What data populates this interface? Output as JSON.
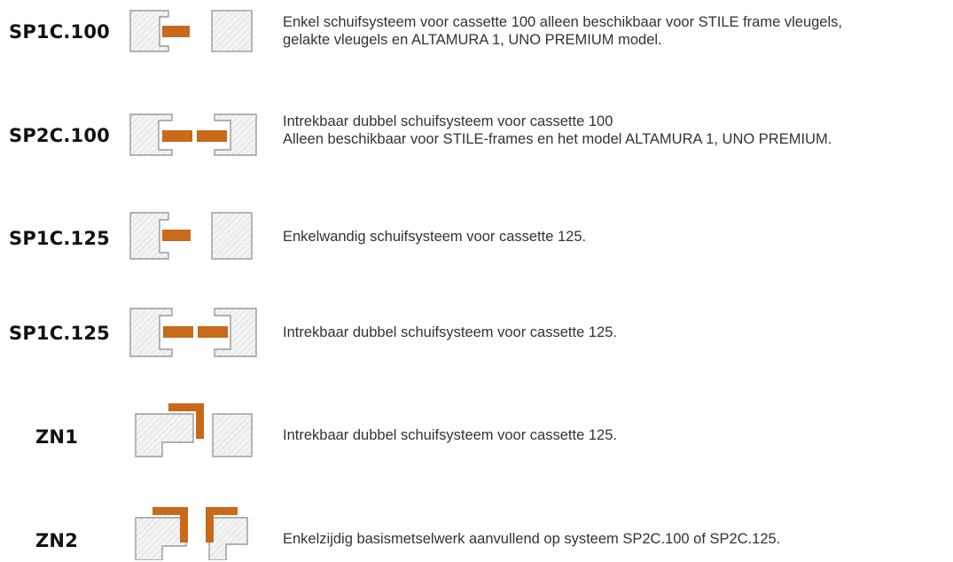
{
  "colors": {
    "accent": "#c9691a",
    "outline": "#9a9a9a",
    "hatch": "#d9d9d9"
  },
  "rows": [
    {
      "code": "SP1C.100",
      "diagram": "single-slider-cassette-icon",
      "lines": [
        "Enkel schuifsysteem voor cassette 100 alleen beschikbaar voor STILE frame vleugels,",
        "gelakte vleugels en ALTAMURA 1, UNO PREMIUM model."
      ]
    },
    {
      "code": "SP2C.100",
      "diagram": "double-slider-cassette-icon",
      "lines": [
        "Intrekbaar dubbel schuifsysteem voor cassette 100",
        "Alleen beschikbaar voor STILE-frames en het model ALTAMURA 1, UNO PREMIUM."
      ]
    },
    {
      "code": "SP1C.125",
      "diagram": "single-slider-cassette-icon",
      "lines": [
        "Enkelwandig schuifsysteem voor cassette 125."
      ]
    },
    {
      "code": "SP1C.125",
      "diagram": "double-slider-cassette-icon",
      "lines": [
        "Intrekbaar dubbel schuifsysteem voor cassette 125."
      ]
    },
    {
      "code": "ZN1",
      "diagram": "single-masonry-corner-icon",
      "lines": [
        "Intrekbaar dubbel schuifsysteem voor cassette 125."
      ]
    },
    {
      "code": "ZN2",
      "diagram": "double-masonry-corner-icon",
      "lines": [
        "Enkelzijdig basismetselwerk aanvullend op systeem SP2C.100 of SP2C.125."
      ]
    }
  ]
}
